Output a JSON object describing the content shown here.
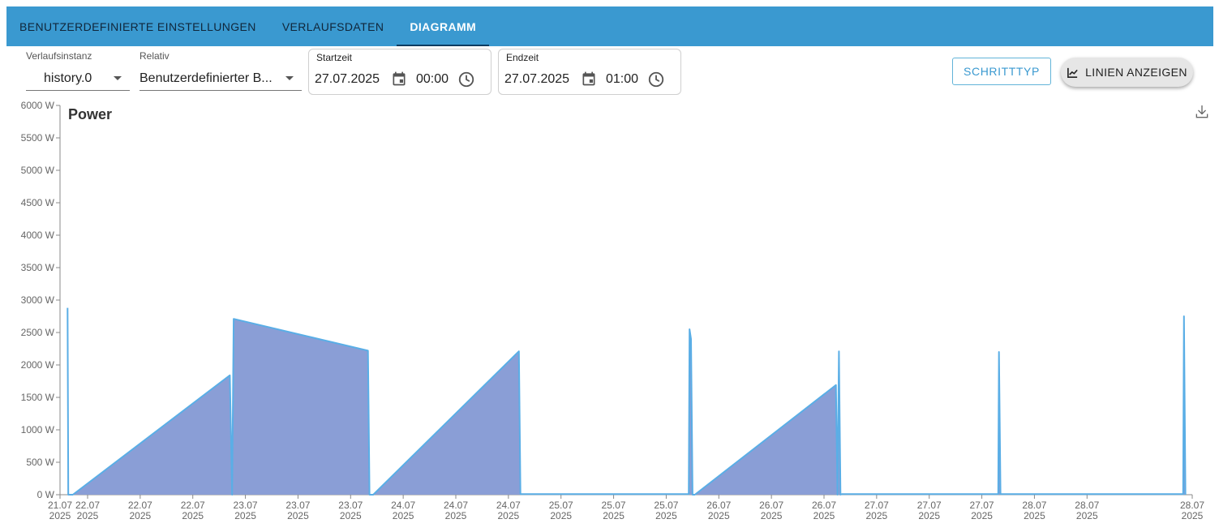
{
  "tabs": [
    {
      "label": "BENUTZERDEFINIERTE EINSTELLUNGEN",
      "active": false
    },
    {
      "label": "VERLAUFSDATEN",
      "active": false
    },
    {
      "label": "DIAGRAMM",
      "active": true
    }
  ],
  "controls": {
    "instance": {
      "label": "Verlaufsinstanz",
      "value": "history.0"
    },
    "relative": {
      "label": "Relativ",
      "value": "Benutzerdefinierter B..."
    },
    "start": {
      "label": "Startzeit",
      "date": "27.07.2025",
      "time": "00:00"
    },
    "end": {
      "label": "Endzeit",
      "date": "27.07.2025",
      "time": "01:00"
    },
    "step_type_button": "SCHRITTTYP",
    "show_lines_button": "LINIEN ANZEIGEN"
  },
  "icons": {
    "calendar": "calendar-icon",
    "clock": "clock-icon",
    "chart_line": "chart-line-icon",
    "download": "download-icon",
    "dropdown": "chevron-down-icon"
  },
  "colors": {
    "tabbar": "#3a99d0",
    "area_fill": "#8a9ed6",
    "line": "#5aaee6"
  },
  "chart_data": {
    "type": "area",
    "title": "Power",
    "unit": "W",
    "y_ticks": [
      "0 W",
      "500 W",
      "1000 W",
      "1500 W",
      "2000 W",
      "2500 W",
      "3000 W",
      "3500 W",
      "4000 W",
      "4500 W",
      "5000 W",
      "5500 W",
      "6000 W"
    ],
    "ylim": [
      0,
      6000
    ],
    "x_ticks": [
      {
        "day": "21.07",
        "year": "2025"
      },
      {
        "day": "22.07",
        "year": "2025"
      },
      {
        "day": "22.07",
        "year": "2025"
      },
      {
        "day": "22.07",
        "year": "2025"
      },
      {
        "day": "23.07",
        "year": "2025"
      },
      {
        "day": "23.07",
        "year": "2025"
      },
      {
        "day": "23.07",
        "year": "2025"
      },
      {
        "day": "24.07",
        "year": "2025"
      },
      {
        "day": "24.07",
        "year": "2025"
      },
      {
        "day": "24.07",
        "year": "2025"
      },
      {
        "day": "25.07",
        "year": "2025"
      },
      {
        "day": "25.07",
        "year": "2025"
      },
      {
        "day": "25.07",
        "year": "2025"
      },
      {
        "day": "26.07",
        "year": "2025"
      },
      {
        "day": "26.07",
        "year": "2025"
      },
      {
        "day": "26.07",
        "year": "2025"
      },
      {
        "day": "27.07",
        "year": "2025"
      },
      {
        "day": "27.07",
        "year": "2025"
      },
      {
        "day": "27.07",
        "year": "2025"
      },
      {
        "day": "28.07",
        "year": "2025"
      },
      {
        "day": "28.07",
        "year": "2025"
      },
      {
        "day": "28.07",
        "year": "2025"
      }
    ],
    "xlim": [
      "2025-07-21 20:00",
      "2025-07-28 02:00"
    ],
    "series": [
      {
        "x": [
          "2025-07-21 21:00",
          "2025-07-21 21:06",
          "2025-07-21 21:12",
          "2025-07-21 21:42",
          "2025-07-22 18:30",
          "2025-07-22 18:48",
          "2025-07-22 19:00",
          "2025-07-23 12:48",
          "2025-07-23 13:00",
          "2025-07-23 13:30",
          "2025-07-24 08:48",
          "2025-07-24 09:00",
          "2025-07-25 07:18",
          "2025-07-25 07:24",
          "2025-07-25 07:36",
          "2025-07-25 07:48",
          "2025-07-25 08:06",
          "2025-07-26 02:48",
          "2025-07-26 03:00",
          "2025-07-26 03:12",
          "2025-07-26 03:24",
          "2025-07-26 03:36",
          "2025-07-27 00:18",
          "2025-07-27 00:24",
          "2025-07-27 00:36",
          "2025-07-28 00:48",
          "2025-07-28 00:54",
          "2025-07-28 01:06"
        ],
        "y": [
          2880,
          0,
          0,
          0,
          1840,
          0,
          2710,
          2220,
          0,
          0,
          2210,
          10,
          10,
          2550,
          2400,
          0,
          0,
          1690,
          0,
          2210,
          0,
          10,
          10,
          2200,
          10,
          10,
          2750,
          0
        ]
      }
    ],
    "grid": false
  }
}
